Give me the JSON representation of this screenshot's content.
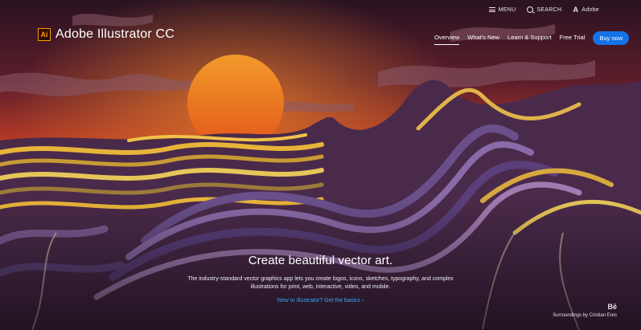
{
  "top_bar": {
    "menu_label": "MENU",
    "search_label": "SEARCH",
    "adobe_label": "Adobe",
    "adobe_icon": "A"
  },
  "brand": {
    "logo_text": "Ai",
    "product_name": "Adobe Illustrator CC"
  },
  "nav": {
    "items": [
      "Overview",
      "What's New",
      "Learn & Support",
      "Free Trial"
    ],
    "active": "Overview",
    "buy_label": "Buy now"
  },
  "hero": {
    "headline": "Create beautiful vector art.",
    "description_line1": "The industry-standard vector graphics app lets you create logos, icons, sketches, typography, and complex",
    "description_line2": "illustrations for print, web, interactive, video, and mobile.",
    "link_label": "New to Illustrator? Get the basics ›"
  },
  "credit": {
    "behance_logo": "Bē",
    "text": "Surroundings by Cristian Eres"
  },
  "colors": {
    "accent": "#1473e6",
    "link": "#39a7f0",
    "logo_orange": "#ff9a00",
    "sun": "#e8701a",
    "sky": "#6a1e2a"
  }
}
